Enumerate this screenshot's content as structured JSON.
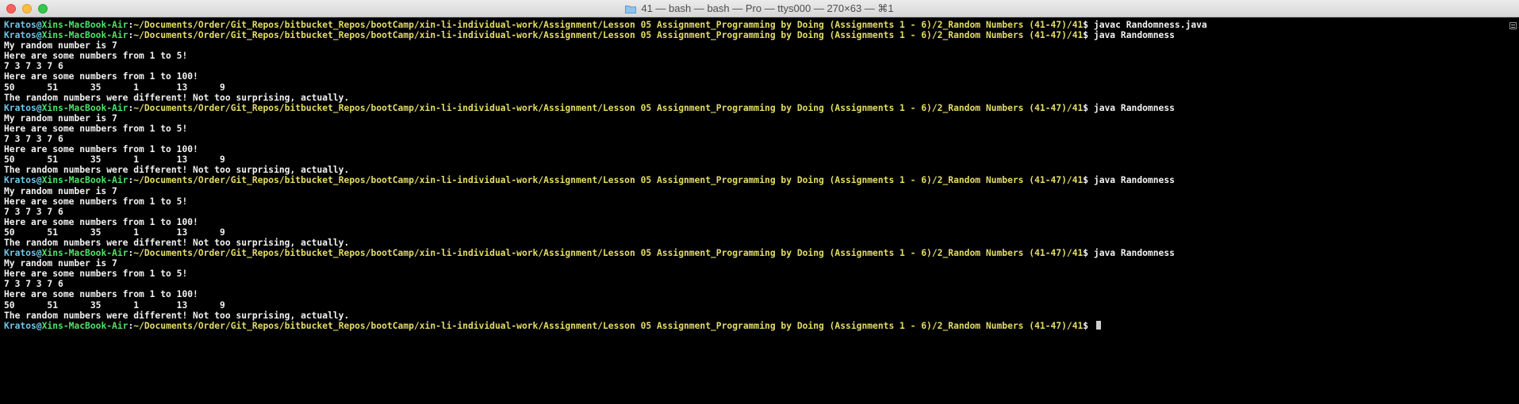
{
  "window": {
    "title": "41 — bash — bash — Pro — ttys000 — 270×63 — ⌘1",
    "icons": [
      "close-button",
      "minimize-button",
      "zoom-button",
      "folder-icon"
    ]
  },
  "colors": {
    "background": "#000000",
    "user": "#6ec6e6",
    "host": "#4fe06a",
    "path": "#e3dc66",
    "text": "#f2f2f2"
  },
  "prompt": {
    "user": "Kratos",
    "at": "@",
    "host": "Xins-MacBook-Air",
    "colon": ":",
    "path": "~/Documents/Order/Git_Repos/bitbucket_Repos/bootCamp/xin-li-individual-work/Assignment/Lesson 05 Assignment_Programming by Doing (Assignments 1 - 6)/2_Random Numbers (41-47)/41",
    "symbol": "$ "
  },
  "lines": [
    {
      "type": "prompt",
      "command": "javac Randomness.java"
    },
    {
      "type": "prompt",
      "command": "java Randomness"
    },
    {
      "type": "output",
      "text": "My random number is 7"
    },
    {
      "type": "output",
      "text": "Here are some numbers from 1 to 5!"
    },
    {
      "type": "output",
      "text": "7 3 7 3 7 6"
    },
    {
      "type": "output",
      "text": "Here are some numbers from 1 to 100!"
    },
    {
      "type": "output",
      "text": "50      51      35      1       13      9"
    },
    {
      "type": "output",
      "text": "The random numbers were different! Not too surprising, actually."
    },
    {
      "type": "prompt",
      "command": "java Randomness"
    },
    {
      "type": "output",
      "text": "My random number is 7"
    },
    {
      "type": "output",
      "text": "Here are some numbers from 1 to 5!"
    },
    {
      "type": "output",
      "text": "7 3 7 3 7 6"
    },
    {
      "type": "output",
      "text": "Here are some numbers from 1 to 100!"
    },
    {
      "type": "output",
      "text": "50      51      35      1       13      9"
    },
    {
      "type": "output",
      "text": "The random numbers were different! Not too surprising, actually."
    },
    {
      "type": "prompt",
      "command": "java Randomness"
    },
    {
      "type": "output",
      "text": "My random number is 7"
    },
    {
      "type": "output",
      "text": "Here are some numbers from 1 to 5!"
    },
    {
      "type": "output",
      "text": "7 3 7 3 7 6"
    },
    {
      "type": "output",
      "text": "Here are some numbers from 1 to 100!"
    },
    {
      "type": "output",
      "text": "50      51      35      1       13      9"
    },
    {
      "type": "output",
      "text": "The random numbers were different! Not too surprising, actually."
    },
    {
      "type": "prompt",
      "command": "java Randomness"
    },
    {
      "type": "output",
      "text": "My random number is 7"
    },
    {
      "type": "output",
      "text": "Here are some numbers from 1 to 5!"
    },
    {
      "type": "output",
      "text": "7 3 7 3 7 6"
    },
    {
      "type": "output",
      "text": "Here are some numbers from 1 to 100!"
    },
    {
      "type": "output",
      "text": "50      51      35      1       13      9"
    },
    {
      "type": "output",
      "text": "The random numbers were different! Not too surprising, actually."
    },
    {
      "type": "prompt",
      "command": "",
      "cursor": true
    }
  ]
}
